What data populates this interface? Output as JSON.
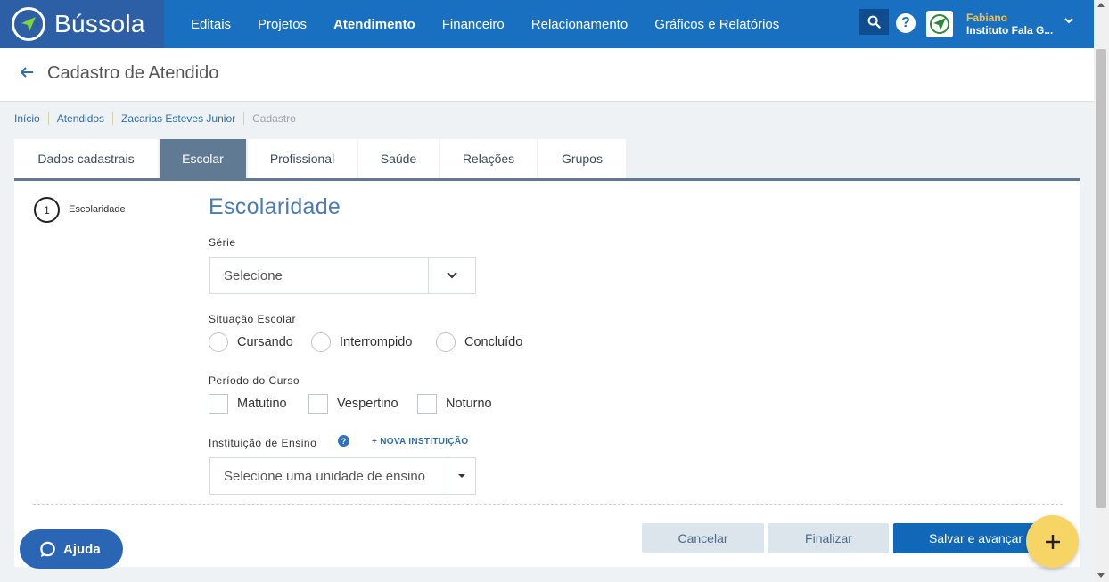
{
  "brand": {
    "name": "Bússola"
  },
  "nav": {
    "items": [
      {
        "label": "Editais"
      },
      {
        "label": "Projetos"
      },
      {
        "label": "Atendimento",
        "active": true
      },
      {
        "label": "Financeiro"
      },
      {
        "label": "Relacionamento"
      },
      {
        "label": "Gráficos e Relatórios"
      }
    ]
  },
  "user": {
    "name": "Fabiano",
    "org": "Instituto Fala G..."
  },
  "header": {
    "title": "Cadastro de Atendido"
  },
  "breadcrumb": [
    "Início",
    "Atendidos",
    "Zacarias Esteves Junior",
    "Cadastro"
  ],
  "tabs": [
    {
      "label": "Dados cadastrais"
    },
    {
      "label": "Escolar",
      "active": true
    },
    {
      "label": "Profissional"
    },
    {
      "label": "Saúde"
    },
    {
      "label": "Relações"
    },
    {
      "label": "Grupos"
    }
  ],
  "steps": [
    {
      "number": "1",
      "label": "Escolaridade"
    }
  ],
  "form": {
    "title": "Escolaridade",
    "serie": {
      "label": "Série",
      "value": "Selecione"
    },
    "situacao": {
      "label": "Situação Escolar",
      "options": [
        "Cursando",
        "Interrompido",
        "Concluído"
      ]
    },
    "periodo": {
      "label": "Período do Curso",
      "options": [
        "Matutino",
        "Vespertino",
        "Noturno"
      ]
    },
    "instituicao": {
      "label": "Instituição de Ensino",
      "help": "?",
      "new_link": "+ NOVA INSTITUIÇÃO",
      "placeholder": "Selecione uma unidade de ensino"
    }
  },
  "actions": {
    "cancel": "Cancelar",
    "finish": "Finalizar",
    "save": "Salvar e avançar"
  },
  "help_button": {
    "label": "Ajuda"
  },
  "colors": {
    "nav": "#1a70c0",
    "brand": "#2d5fa6",
    "tab_active": "#617a94",
    "primary": "#1168b8",
    "fab": "#f7d564"
  }
}
